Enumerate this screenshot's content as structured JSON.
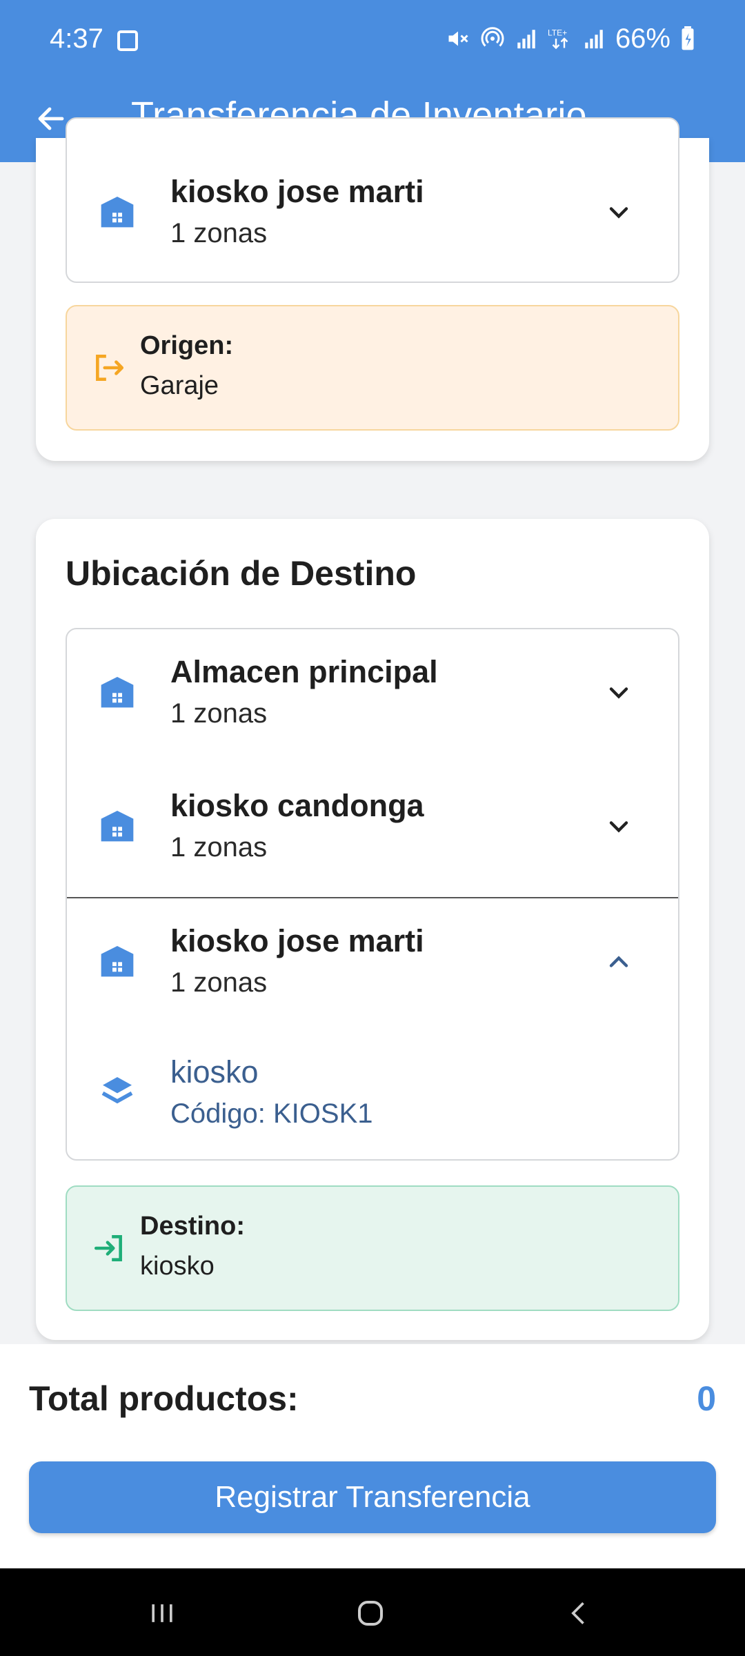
{
  "status_bar": {
    "time": "4:37",
    "battery": "66%",
    "icons": [
      "image-icon",
      "mute-icon",
      "hotspot-icon",
      "signal-icon",
      "lte-icon",
      "signal-icon",
      "battery-icon"
    ]
  },
  "app_bar": {
    "title": "Transferencia de Inventario",
    "back_icon": "arrow-back-icon"
  },
  "origin_card": {
    "selected_row": {
      "name": "kiosko jose marti",
      "zones": "1 zonas"
    },
    "info": {
      "label": "Origen:",
      "value": "Garaje"
    }
  },
  "destination_card": {
    "title": "Ubicación de Destino",
    "warehouses": [
      {
        "name": "Almacen principal",
        "zones": "1 zonas",
        "expanded": false
      },
      {
        "name": "kiosko candonga",
        "zones": "1 zonas",
        "expanded": false
      },
      {
        "name": "kiosko jose marti",
        "zones": "1 zonas",
        "expanded": true
      }
    ],
    "zone": {
      "name": "kiosko",
      "code": "Código: KIOSK1"
    },
    "info": {
      "label": "Destino:",
      "value": "kiosko"
    }
  },
  "footer": {
    "total_label": "Total productos:",
    "total_value": "0",
    "submit_label": "Registrar Transferencia"
  },
  "colors": {
    "primary": "#4a8ddf",
    "origin_bg": "#fff1e3",
    "origin_accent": "#f5a623",
    "dest_bg": "#e6f5ee",
    "dest_accent": "#1fae78",
    "zone_text": "#3b5f8f"
  }
}
